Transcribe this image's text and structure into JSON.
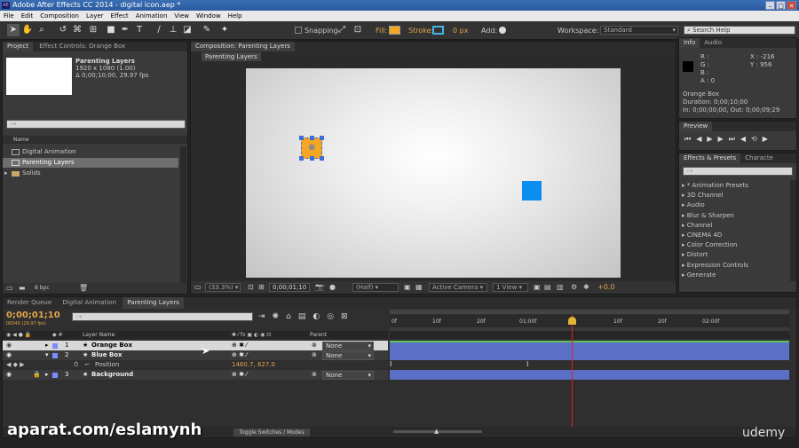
{
  "app": {
    "title": "Adobe After Effects CC 2014 - digital icon.aep *",
    "icon": "AE"
  },
  "menu": [
    "File",
    "Edit",
    "Composition",
    "Layer",
    "Effect",
    "Animation",
    "View",
    "Window",
    "Help"
  ],
  "toolbar": {
    "snapping": "Snapping",
    "fill": "Fill:",
    "stroke": "Stroke:",
    "stroke_px": "0 px",
    "add": "Add:",
    "workspace_label": "Workspace:",
    "workspace_value": "Standard",
    "search_placeholder": "Search Help"
  },
  "project": {
    "tab_project": "Project",
    "tab_effect": "Effect Controls: Orange Box",
    "comp_name": "Parenting Layers",
    "comp_res": "1920 x 1080 (1.00)",
    "comp_dur": "Δ 0;00;10;00, 29.97 fps",
    "col_name": "Name",
    "items": [
      "Digital Animation",
      "Parenting Layers",
      "Solids"
    ],
    "bpc": "8 bpc"
  },
  "composition": {
    "tab": "Composition: Parenting Layers",
    "breadcrumb": "Parenting Layers",
    "zoom": "(33.3%)",
    "time": "0;00;01;10",
    "res": "(Half)",
    "camera": "Active Camera",
    "views": "1 View",
    "exposure": "+0.0"
  },
  "info": {
    "tab_info": "Info",
    "tab_audio": "Audio",
    "r": "R :",
    "g": "G :",
    "b": "B :",
    "a": "A : 0",
    "x": "X : -216",
    "y": "Y : 956",
    "layer": "Orange Box",
    "duration": "Duration: 0;00;10;00",
    "inout": "In: 0;00;00;00, Out: 0;00;09;29"
  },
  "preview": {
    "tab": "Preview"
  },
  "effects": {
    "tab": "Effects & Presets",
    "tab2": "Characte",
    "items": [
      "* Animation Presets",
      "3D Channel",
      "Audio",
      "Blur & Sharpen",
      "Channel",
      "CINEMA 4D",
      "Color Correction",
      "Distort",
      "Expression Controls",
      "Generate"
    ]
  },
  "timeline": {
    "tabs": [
      "Render Queue",
      "Digital Animation",
      "Parenting Layers"
    ],
    "timecode": "0;00;01;10",
    "frames": "00040 (29.97 fps)",
    "col_layer": "Layer Name",
    "col_parent": "Parent",
    "layers": [
      {
        "num": "1",
        "name": "Orange Box",
        "parent": "None"
      },
      {
        "num": "2",
        "name": "Blue Box",
        "parent": "None"
      },
      {
        "num": "3",
        "name": "Background",
        "parent": "None"
      }
    ],
    "position_label": "Position",
    "position_value": "1460.7, 627.0",
    "ruler": [
      "0f",
      "10f",
      "20f",
      "01:00f",
      "10f",
      "20f",
      "02:00f",
      "10f",
      "20f"
    ],
    "toggle": "Toggle Switches / Modes"
  },
  "watermarks": {
    "left": "aparat.com/eslamynh",
    "right": "udemy"
  },
  "colors": {
    "orange": "#f5a623",
    "blue": "#0b8ef0",
    "layer_bar": "#5b6fc6",
    "playhead": "#e02020"
  }
}
